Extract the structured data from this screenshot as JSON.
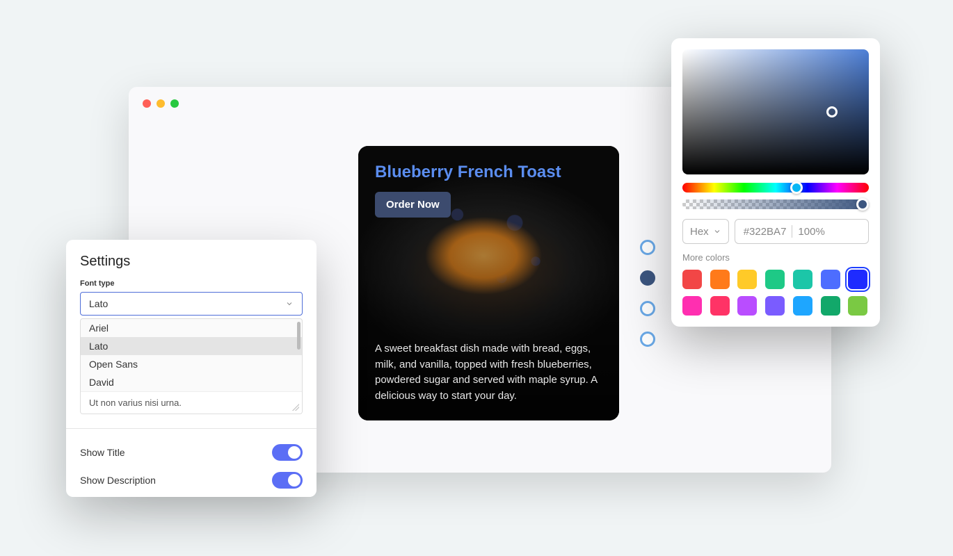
{
  "browser": {
    "traffic_lights": [
      "red",
      "yellow",
      "green"
    ]
  },
  "recipe": {
    "title": "Blueberry French Toast",
    "button_label": "Order Now",
    "description": "A sweet breakfast dish made with bread, eggs, milk, and vanilla, topped with fresh blueberries, powdered sugar and served with maple syrup. A delicious way to start your day."
  },
  "side_nav": {
    "dots": [
      {
        "filled": false
      },
      {
        "filled": true
      },
      {
        "filled": false
      },
      {
        "filled": false
      }
    ]
  },
  "settings": {
    "title": "Settings",
    "font_type_label": "Font type",
    "font_selected": "Lato",
    "font_options": [
      "Ariel",
      "Lato",
      "Open Sans",
      "David"
    ],
    "textarea_value": "Ut non varius nisi urna.",
    "toggles": [
      {
        "label": "Show Title",
        "on": true
      },
      {
        "label": "Show Description",
        "on": true
      }
    ]
  },
  "color_picker": {
    "format": "Hex",
    "hex_value": "#322BA7",
    "opacity": "100%",
    "more_label": "More colors",
    "swatches_row1": [
      "#f24646",
      "#ff7a1a",
      "#ffca28",
      "#1ec986",
      "#1cc6a8",
      "#4d6dff",
      "#1e2bff"
    ],
    "swatches_row2": [
      "#ff2fb0",
      "#ff3366",
      "#b94dff",
      "#7a5cff",
      "#1ea6ff",
      "#12a86a",
      "#7ac943"
    ],
    "selected_swatch_index": 6
  }
}
